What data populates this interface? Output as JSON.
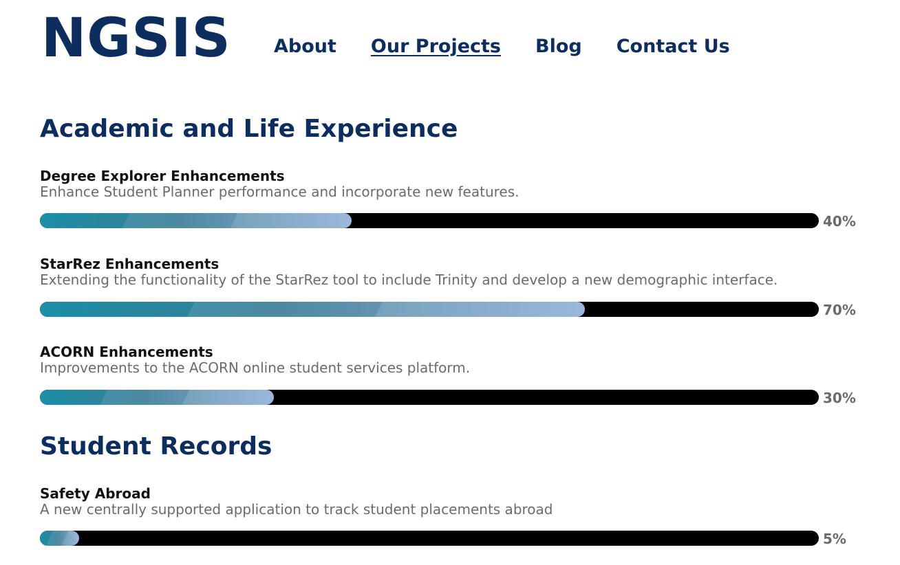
{
  "header": {
    "logo": "NGSIS",
    "nav": [
      {
        "label": "About"
      },
      {
        "label": "Our Projects"
      },
      {
        "label": "Blog"
      },
      {
        "label": "Contact Us"
      }
    ],
    "active_nav": "Our Projects"
  },
  "sections": [
    {
      "title": "Academic and Life Experience",
      "projects": [
        {
          "name": "Degree Explorer Enhancements",
          "description": "Enhance Student Planner performance and incorporate new features.",
          "progress_label": "40%",
          "progress": 0.4
        },
        {
          "name": "StarRez Enhancements",
          "description": "Extending the functionality of the StarRez tool to include Trinity and develop a new demographic interface.",
          "progress_label": "70%",
          "progress": 0.7
        },
        {
          "name": "ACORN Enhancements",
          "description": "Improvements to the ACORN online student services platform.",
          "progress_label": "30%",
          "progress": 0.3
        }
      ]
    },
    {
      "title": "Student Records",
      "projects": [
        {
          "name": "Safety Abroad",
          "description": "A new centrally supported application to track student placements abroad",
          "progress_label": "5%",
          "progress": 0.05
        }
      ]
    }
  ],
  "colors": {
    "brand": "#0d2d5e",
    "track": "#000000",
    "fill_start": "#1b8fa6",
    "fill_end": "#7fa3d0",
    "muted_text": "#6b6b6b"
  }
}
